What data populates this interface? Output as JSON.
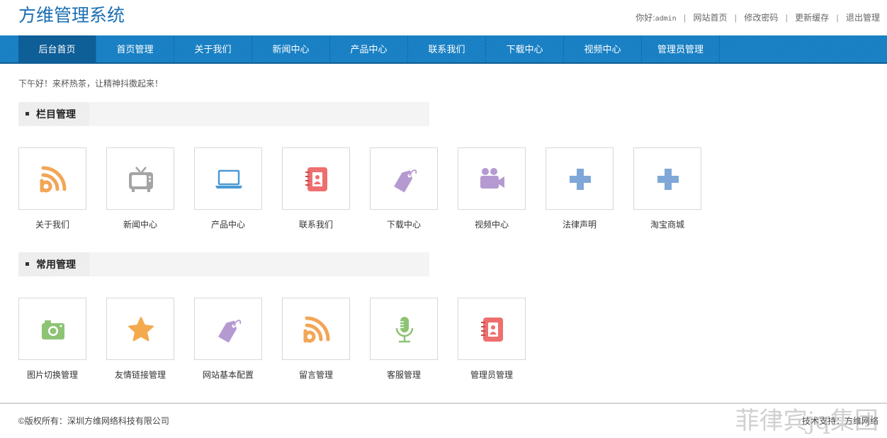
{
  "app": {
    "title": "方维管理系统"
  },
  "top_links": {
    "greeting_prefix": "你好:",
    "user": "admin",
    "site_home": "网站首页",
    "change_password": "修改密码",
    "refresh_cache": "更新缓存",
    "logout": "退出管理",
    "separator": "|"
  },
  "nav": {
    "items": [
      {
        "label": "后台首页",
        "active": true
      },
      {
        "label": "首页管理"
      },
      {
        "label": "关于我们"
      },
      {
        "label": "新闻中心"
      },
      {
        "label": "产品中心"
      },
      {
        "label": "联系我们"
      },
      {
        "label": "下载中心"
      },
      {
        "label": "视频中心"
      },
      {
        "label": "管理员管理"
      }
    ]
  },
  "greeting": "下午好！来杯热茶，让精神抖擞起来！",
  "sections": [
    {
      "title": "栏目管理",
      "items": [
        {
          "label": "关于我们",
          "icon": "rss-icon",
          "color": "#f2a657"
        },
        {
          "label": "新闻中心",
          "icon": "tv-icon",
          "color": "#a5a5a5"
        },
        {
          "label": "产品中心",
          "icon": "laptop-icon",
          "color": "#4a9ad6"
        },
        {
          "label": "联系我们",
          "icon": "contact-book-icon",
          "color": "#ee6f6f"
        },
        {
          "label": "下载中心",
          "icon": "tag-icon",
          "color": "#b49ad1"
        },
        {
          "label": "视频中心",
          "icon": "video-camera-icon",
          "color": "#b49ad1"
        },
        {
          "label": "法律声明",
          "icon": "plus-icon",
          "color": "#7fa8d8"
        },
        {
          "label": "淘宝商城",
          "icon": "plus-icon",
          "color": "#7fa8d8"
        }
      ]
    },
    {
      "title": "常用管理",
      "items": [
        {
          "label": "图片切换管理",
          "icon": "camera-icon",
          "color": "#8cc474"
        },
        {
          "label": "友情链接管理",
          "icon": "star-icon",
          "color": "#f5a94e"
        },
        {
          "label": "网站基本配置",
          "icon": "tag-icon",
          "color": "#b49ad1"
        },
        {
          "label": "留言管理",
          "icon": "rss-icon",
          "color": "#f2a657"
        },
        {
          "label": "客服管理",
          "icon": "microphone-icon",
          "color": "#8cc474"
        },
        {
          "label": "管理员管理",
          "icon": "contact-book-icon",
          "color": "#ee6f6f"
        }
      ]
    }
  ],
  "footer": {
    "copyright": "©版权所有：深圳方维网络科技有限公司",
    "support": "技术支持：方维网络",
    "watermark": "菲律宾jq集团"
  }
}
